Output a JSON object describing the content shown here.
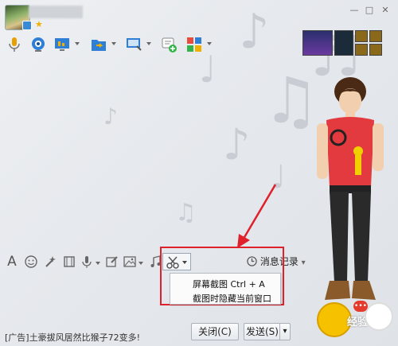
{
  "window": {
    "controls": {
      "minimize": "—",
      "maximize": "□",
      "close": "✕"
    }
  },
  "toolbar": {
    "icons": [
      "microphone-icon",
      "webcam-icon",
      "screen-share-icon",
      "file-transfer-icon",
      "remote-desktop-icon",
      "apps-add-icon",
      "app-grid-icon"
    ]
  },
  "edit_toolbar": {
    "font_icon": "A",
    "history_label": "消息记录",
    "history_caret": "▾"
  },
  "screenshot_menu": {
    "items": [
      {
        "label": "屏幕截图 Ctrl + A"
      },
      {
        "label": "截图时隐藏当前窗口"
      }
    ]
  },
  "footer": {
    "ad_text": "[广告]土豪拔风居然比猴子72变多!",
    "close_label": "关闭(C)",
    "send_label": "发送(S)",
    "send_caret": "▾"
  },
  "watermark": {
    "text": "经验"
  },
  "colors": {
    "highlight": "#e0202a",
    "accent_blue": "#2f7fd6",
    "window_bg": "#e6e9ed"
  }
}
